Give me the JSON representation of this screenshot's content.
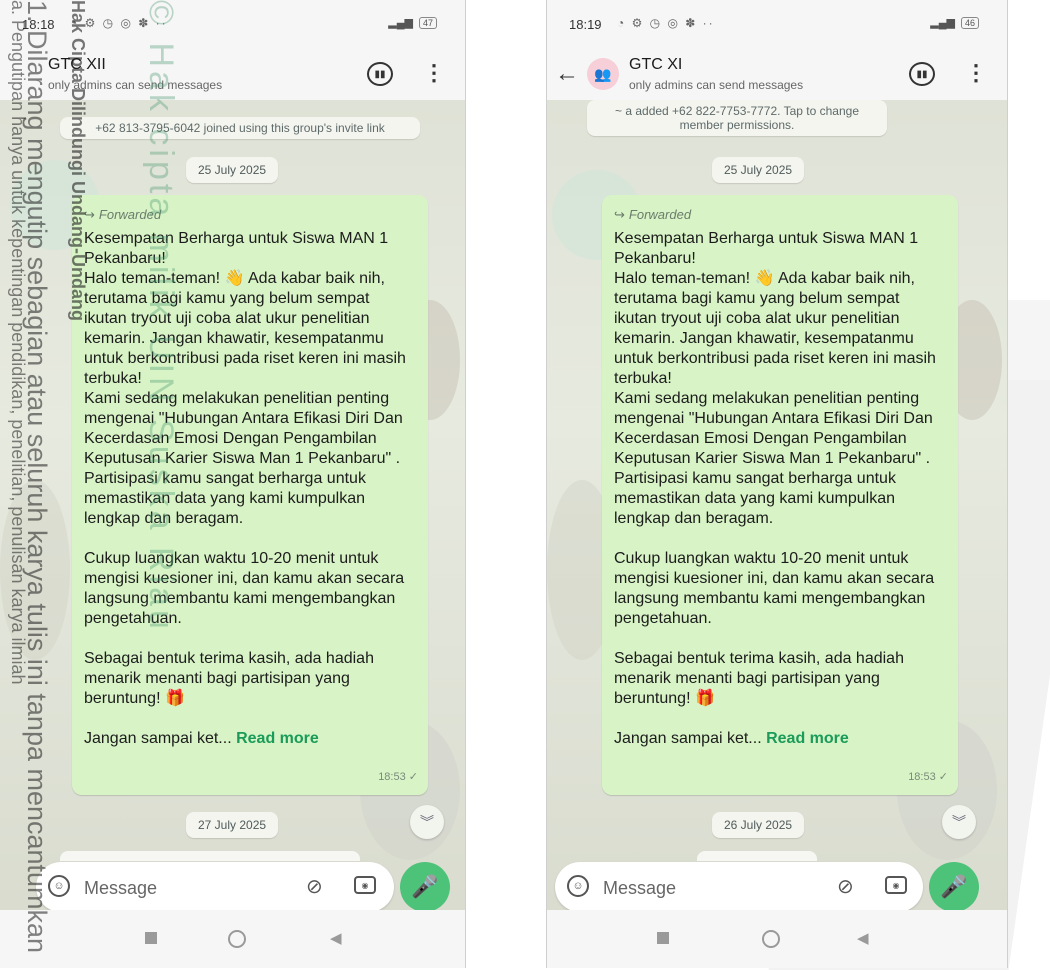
{
  "left_phone": {
    "status": {
      "time": "18:18",
      "battery": "47"
    },
    "header": {
      "title": "GTC XII",
      "subtitle": "only admins can send messages"
    },
    "system_message": "+62 813-3795-6042 joined using this group's invite link",
    "date_top": "25 July 2025",
    "date_bottom": "27 July 2025",
    "message": {
      "forwarded": "Forwarded",
      "p1": "Kesempatan Berharga untuk Siswa MAN 1 Pekanbaru!\nHalo teman-teman! 👋 Ada kabar baik nih, terutama bagi kamu yang belum sempat ikutan tryout uji coba alat ukur penelitian kemarin. Jangan khawatir, kesempatanmu untuk berkontribusi pada riset keren ini masih terbuka!\nKami sedang melakukan penelitian penting mengenai \"Hubungan Antara Efikasi Diri Dan Kecerdasan Emosi Dengan Pengambilan Keputusan Karier Siswa Man 1 Pekanbaru\" . Partisipasi kamu sangat berharga untuk memastikan data yang kami kumpulkan lengkap dan beragam.",
      "p2": "Cukup luangkan waktu 10-20 menit untuk mengisi kuesioner ini, dan kamu akan secara langsung membantu kami mengembangkan pengetahuan.",
      "p3": "Sebagai bentuk terima kasih, ada hadiah menarik menanti bagi partisipan yang beruntung! 🎁",
      "truncated": "Jangan sampai ket...",
      "read_more": "Read more",
      "time": "18:53 ✓"
    },
    "input_placeholder": "Message"
  },
  "right_phone": {
    "status": {
      "time": "18:19",
      "battery": "46"
    },
    "header": {
      "title": "GTC XI",
      "subtitle": "only admins can send messages"
    },
    "system_message": "~ a added +62 822-7753-7772. Tap to change member permissions.",
    "date_top": "25 July 2025",
    "date_bottom": "26 July 2025",
    "message": {
      "forwarded": "Forwarded",
      "p1": "Kesempatan Berharga untuk Siswa MAN 1 Pekanbaru!\nHalo teman-teman! 👋 Ada kabar baik nih, terutama bagi kamu yang belum sempat ikutan tryout uji coba alat ukur penelitian kemarin. Jangan khawatir, kesempatanmu untuk berkontribusi pada riset keren ini masih terbuka!\nKami sedang melakukan penelitian penting mengenai \"Hubungan Antara Efikasi Diri Dan Kecerdasan Emosi Dengan Pengambilan Keputusan Karier Siswa Man 1 Pekanbaru\" . Partisipasi kamu sangat berharga untuk memastikan data yang kami kumpulkan lengkap dan beragam.",
      "p2": "Cukup luangkan waktu 10-20 menit untuk mengisi kuesioner ini, dan kamu akan secara langsung membantu kami mengembangkan pengetahuan.",
      "p3": "Sebagai bentuk terima kasih, ada hadiah menarik menanti bagi partisipan yang beruntung! 🎁",
      "truncated": "Jangan sampai ket...",
      "read_more": "Read more",
      "time": "18:53 ✓"
    },
    "input_placeholder": "Message"
  },
  "watermark": {
    "line1": "1. Dilarang mengutip sebagian atau seluruh karya tulis ini tanpa mencantumkan",
    "line2": "Hak Cipta Dilindungi Undang-Undang",
    "line3": "© Hak cipta milik UIN Suska Riau",
    "line4": "a. Pengutipan hanya untuk kepentingan pendidikan, penelitian, penulisan karya ilmiah"
  }
}
